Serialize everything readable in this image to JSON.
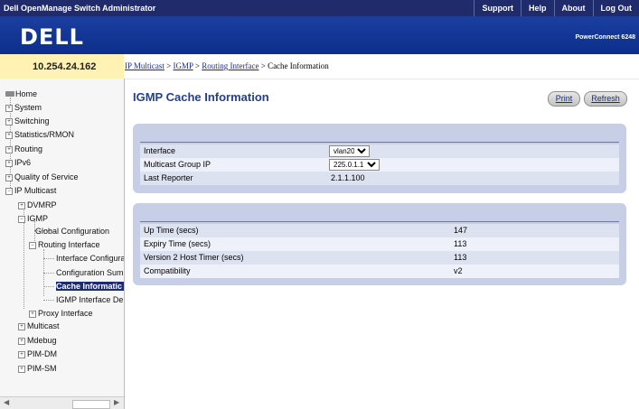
{
  "header": {
    "app_title": "Dell OpenManage Switch Administrator",
    "links": [
      "Support",
      "Help",
      "About",
      "Log Out"
    ],
    "logo": "DELL",
    "product": "PowerConnect 6248"
  },
  "ip_address": "10.254.24.162",
  "breadcrumb": {
    "items": [
      "IP Multicast",
      "IGMP",
      "Routing Interface"
    ],
    "current": "Cache Information",
    "separator": ">"
  },
  "sidebar": {
    "home": "Home",
    "system": "System",
    "switching": "Switching",
    "statistics": "Statistics/RMON",
    "routing": "Routing",
    "ipv6": "IPv6",
    "qos": "Quality of Service",
    "ip_multicast": "IP Multicast",
    "dvmrp": "DVMRP",
    "igmp": "IGMP",
    "global_config": "Global Configuration",
    "routing_interface": "Routing Interface",
    "interface_config": "Interface Configura",
    "config_summary": "Configuration Sum",
    "cache_info": "Cache Informatic",
    "igmp_interface_detail": "IGMP Interface De",
    "proxy_interface": "Proxy Interface",
    "multicast": "Multicast",
    "mdebug": "Mdebug",
    "pim_dm": "PIM-DM",
    "pim_sm": "PIM-SM"
  },
  "page": {
    "title": "IGMP Cache Information",
    "print_label": "Print",
    "refresh_label": "Refresh"
  },
  "form": {
    "interface_label": "Interface",
    "interface_value": "vlan20",
    "group_label": "Multicast Group IP",
    "group_value": "225.0.1.1",
    "reporter_label": "Last Reporter",
    "reporter_value": "2.1.1.100"
  },
  "stats": {
    "uptime_label": "Up Time (secs)",
    "uptime_value": "147",
    "expiry_label": "Expiry Time (secs)",
    "expiry_value": "113",
    "v2timer_label": "Version 2 Host Timer (secs)",
    "v2timer_value": "113",
    "compat_label": "Compatibility",
    "compat_value": "v2"
  },
  "colors": {
    "header_bg": "#1f2b6b",
    "banner_bg": "#0c2e8c",
    "ip_bar_bg": "#fff2b3",
    "panel_bg": "#c7cfe6",
    "title_color": "#26408a",
    "selected_bg": "#1d2a6e"
  }
}
